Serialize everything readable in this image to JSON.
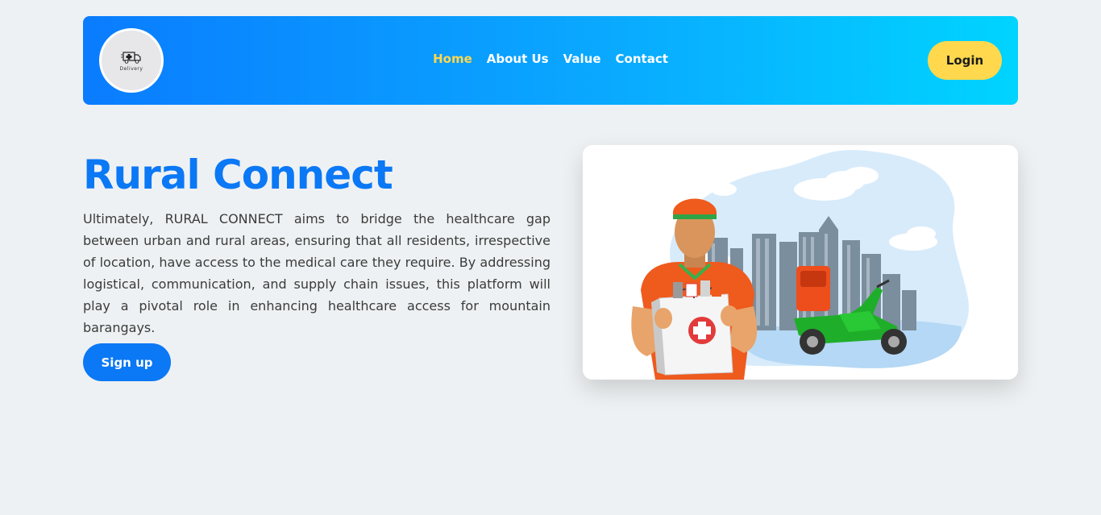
{
  "nav": {
    "logo_icon": "ambulance-icon",
    "logo_text": "Delivery",
    "links": [
      {
        "label": "Home",
        "active": true
      },
      {
        "label": "About Us",
        "active": false
      },
      {
        "label": "Value",
        "active": false
      },
      {
        "label": "Contact",
        "active": false
      }
    ],
    "login_label": "Login"
  },
  "hero": {
    "title": "Rural Connect",
    "description": "Ultimately, RURAL CONNECT aims to bridge the healthcare gap between urban and rural areas, ensuring that all residents, irrespective of location, have access to the medical care they require. By addressing logistical, communication, and supply chain issues, this platform will play a pivotal role in enhancing healthcare access for mountain barangays.",
    "signup_label": "Sign up",
    "illustration": "medicine-delivery-courier-illustration"
  },
  "colors": {
    "primary": "#0b78f5",
    "accent": "#ffd84d",
    "background": "#eef1f3",
    "nav_gradient_start": "#0a7cff",
    "nav_gradient_end": "#00d4ff"
  }
}
